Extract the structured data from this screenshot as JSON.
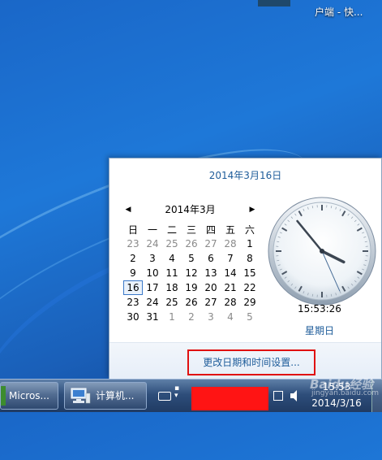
{
  "desktop": {
    "icon_label": "户端 - 快..."
  },
  "popup": {
    "header_date": "2014年3月16日",
    "calendar": {
      "month_title": "2014年3月",
      "prev_symbol": "◀",
      "next_symbol": "▶",
      "weekdays": [
        "日",
        "一",
        "二",
        "三",
        "四",
        "五",
        "六"
      ],
      "weeks": [
        [
          "23",
          "24",
          "25",
          "26",
          "27",
          "28",
          "1"
        ],
        [
          "2",
          "3",
          "4",
          "5",
          "6",
          "7",
          "8"
        ],
        [
          "9",
          "10",
          "11",
          "12",
          "13",
          "14",
          "15"
        ],
        [
          "16",
          "17",
          "18",
          "19",
          "20",
          "21",
          "22"
        ],
        [
          "23",
          "24",
          "25",
          "26",
          "27",
          "28",
          "29"
        ],
        [
          "30",
          "31",
          "1",
          "2",
          "3",
          "4",
          "5"
        ]
      ],
      "other_month_flags": [
        [
          true,
          true,
          true,
          true,
          true,
          true,
          false
        ],
        [
          false,
          false,
          false,
          false,
          false,
          false,
          false
        ],
        [
          false,
          false,
          false,
          false,
          false,
          false,
          false
        ],
        [
          false,
          false,
          false,
          false,
          false,
          false,
          false
        ],
        [
          false,
          false,
          false,
          false,
          false,
          false,
          false
        ],
        [
          false,
          false,
          true,
          true,
          true,
          true,
          true
        ]
      ],
      "today": "16"
    },
    "clock": {
      "hour": 15,
      "minute": 53,
      "second": 26
    },
    "time_text": "15:53:26",
    "weekday_text": "星期日",
    "settings_link": "更改日期和时间设置..."
  },
  "taskbar": {
    "button1_label": "Micros...",
    "button2_label": "计算机...",
    "tray_time": "15:53",
    "tray_date": "2014/3/16"
  },
  "watermark": {
    "text": "Baidu经验",
    "sub": "jingyan.baidu.com"
  },
  "colors": {
    "accent_text": "#1e5c9a",
    "highlight_border": "#e01010",
    "redacted": "#ff1414"
  }
}
